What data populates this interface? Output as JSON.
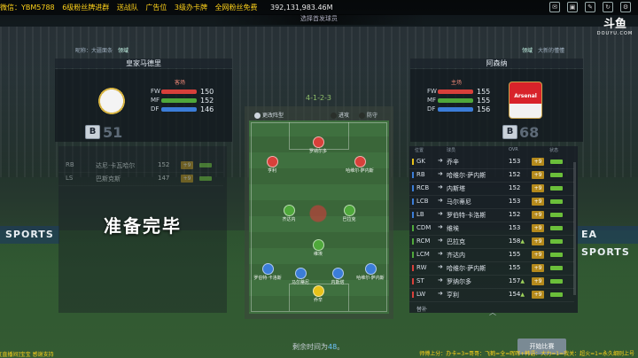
{
  "ticker": [
    "微信：YBM5788",
    "6级粉丝牌进群",
    "送战队",
    "广告位",
    "3级办卡牌",
    "全网粉丝免费"
  ],
  "money": "392,131,983.46M",
  "window_title": "选择首发球员",
  "brand": {
    "logo": "斗鱼",
    "logo_sub": "DOUYU.COM"
  },
  "left_team": {
    "name": "皇家马德里",
    "hdr_left": "昵称：大疆面条",
    "hdr_tag": "领域",
    "side": "客场",
    "stats": [
      {
        "label": "FW",
        "value": "150",
        "color": "#d8403a"
      },
      {
        "label": "MF",
        "value": "152",
        "color": "#4fa83b"
      },
      {
        "label": "DF",
        "value": "146",
        "color": "#3b7dd8"
      }
    ],
    "rating_letter": "B",
    "rating": "51"
  },
  "right_team": {
    "name": "阿森纳",
    "hdr_tag": "领域",
    "hdr_right": "大新的懂懂",
    "side": "主场",
    "stats": [
      {
        "label": "FW",
        "value": "155",
        "color": "#d8403a"
      },
      {
        "label": "MF",
        "value": "155",
        "color": "#4fa83b"
      },
      {
        "label": "DF",
        "value": "156",
        "color": "#3b7dd8"
      }
    ],
    "rating_letter": "B",
    "rating": "68"
  },
  "left_list_rows": [
    {
      "pos": "RB",
      "name": "达尼·卡瓦哈尔",
      "ov": "152"
    },
    {
      "pos": "LS",
      "name": "巴斯克斯",
      "ov": "147"
    }
  ],
  "right_list": {
    "header": [
      "位置",
      "",
      "球员",
      "",
      "OVR",
      "",
      "状态"
    ],
    "rows": [
      {
        "pos": "GK",
        "name": "乔辛",
        "ov": "153",
        "pc": "+9",
        "up": ""
      },
      {
        "pos": "RB",
        "name": "哈维尔·萨内斯",
        "ov": "152",
        "pc": "+9",
        "up": ""
      },
      {
        "pos": "RCB",
        "name": "内斯塔",
        "ov": "152",
        "pc": "+9",
        "up": ""
      },
      {
        "pos": "LCB",
        "name": "马尔蒂尼",
        "ov": "153",
        "pc": "+9",
        "up": ""
      },
      {
        "pos": "LB",
        "name": "罗伯特·卡洛斯",
        "ov": "152",
        "pc": "+9",
        "up": ""
      },
      {
        "pos": "CDM",
        "name": "维埃",
        "ov": "153",
        "pc": "+9",
        "up": ""
      },
      {
        "pos": "RCM",
        "name": "巴拉克",
        "ov": "158",
        "pc": "+9",
        "up": "▲"
      },
      {
        "pos": "LCM",
        "name": "齐达内",
        "ov": "155",
        "pc": "+9",
        "up": ""
      },
      {
        "pos": "RW",
        "name": "哈维尔·萨内斯",
        "ov": "155",
        "pc": "+9",
        "up": ""
      },
      {
        "pos": "ST",
        "name": "罗纳尔多",
        "ov": "157",
        "pc": "+9",
        "up": "▲"
      },
      {
        "pos": "LW",
        "name": "亨利",
        "ov": "154",
        "pc": "+9",
        "up": "▲"
      }
    ],
    "add_label": "替补"
  },
  "formation": "4-1-2-3",
  "pitch_tabs": [
    "更改阵型",
    "进攻",
    "防守"
  ],
  "pitch_players": [
    {
      "name": "罗纳尔多",
      "color": "#d8403a"
    },
    {
      "name": "亨利",
      "color": "#d8403a"
    },
    {
      "name": "哈维尔·萨内斯",
      "color": "#d8403a"
    },
    {
      "name": "齐达内",
      "color": "#4fa83b"
    },
    {
      "name": "巴拉克",
      "color": "#4fa83b"
    },
    {
      "name": "维埃",
      "color": "#4fa83b"
    },
    {
      "name": "罗伯特·卡洛斯",
      "color": "#3b7dd8"
    },
    {
      "name": "马尔蒂尼",
      "color": "#3b7dd8"
    },
    {
      "name": "内斯塔",
      "color": "#3b7dd8"
    },
    {
      "name": "哈维尔·萨内斯",
      "color": "#3b7dd8"
    },
    {
      "name": "乔辛",
      "color": "#e8c21a"
    }
  ],
  "ready_text": "准备完毕",
  "timer": {
    "label": "剩余时间为",
    "value": "48",
    "suffix": "。"
  },
  "main_button": "开始比赛",
  "overlay_left": "[直播间]宝宝 感谢支持",
  "overlay_right": "师傅上分：办卡=3=哥哥：飞鹤=全=晖晖+韩语：大力=1=我关：超火=1=永久细则上号",
  "ad_left": "SPORTS",
  "ad_right": "EA SPORTS"
}
